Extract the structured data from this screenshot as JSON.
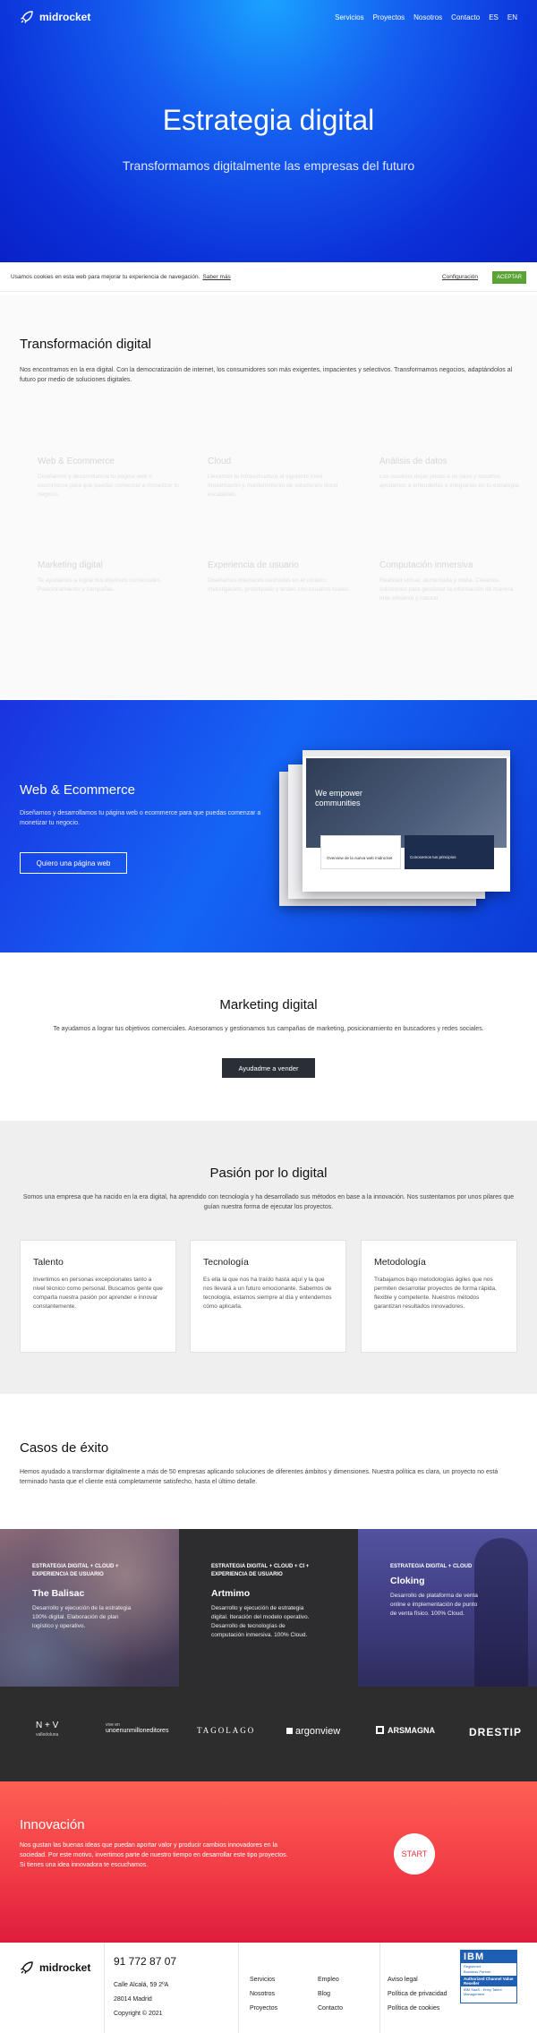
{
  "nav": {
    "brand": "midrocket",
    "links": [
      "Servicios",
      "Proyectos",
      "Nosotros",
      "Contacto",
      "ES",
      "EN"
    ]
  },
  "hero": {
    "title": "Estrategia digital",
    "subtitle": "Transformamos digitalmente las empresas del futuro"
  },
  "cookie": {
    "text": "Usamos cookies en esta web para mejorar tu experiencia de navegación.",
    "more": "Saber más",
    "config": "Configuración",
    "accept": "ACEPTAR"
  },
  "transform": {
    "title": "Transformación digital",
    "text": "Nos encontramos en la era digital. Con la democratización de internet, los consumidores son más exigentes, impacientes y selectivos. Transformamos negocios, adaptándolos al futuro por medio de soluciones digitales.",
    "services": [
      {
        "title": "Web & Ecommerce",
        "text": "Diseñamos y desarrollamos tu página web o ecommerce para que puedas comenzar a monetizar tu negocio."
      },
      {
        "title": "Cloud",
        "text": "Llevamos tu infraestructura al siguiente nivel. Implantación y mantenimiento de soluciones cloud escalables."
      },
      {
        "title": "Análisis de datos",
        "text": "Los usuarios dejan pistas a su paso y nosotros ayudamos a entenderlas e integrarlas en tu estrategia."
      },
      {
        "title": "Marketing digital",
        "text": "Te ayudamos a lograr tus objetivos comerciales. Posicionamiento y campañas."
      },
      {
        "title": "Experiencia de usuario",
        "text": "Diseñamos interfaces centradas en el usuario. Investigación, prototipado y testeo con usuarios reales."
      },
      {
        "title": "Computación inmersiva",
        "text": "Realidad virtual, aumentada y mixta. Creamos soluciones para gestionar la información de manera más eficiente y natural."
      }
    ]
  },
  "web": {
    "title": "Web & Ecommerce",
    "text": "Diseñamos y desarrollamos tu página web o ecommerce para que puedas comenzar a monetizar tu negocio.",
    "button": "Quiero una página web",
    "mock_heading": "We empower communities",
    "mock_card1": "Overview de la nueva web midrocket",
    "mock_card2": "Conocemos tus principios"
  },
  "marketing": {
    "title": "Marketing digital",
    "text": "Te ayudamos a lograr tus objetivos comerciales. Asesoramos y gestionamos tus campañas de marketing, posicionamiento en buscadores y redes sociales.",
    "button": "Ayudadme a vender"
  },
  "pasion": {
    "title": "Pasión por lo digital",
    "text": "Somos una empresa que ha nacido en la era digital, ha aprendido con tecnología y ha desarrollado sus métodos en base a la innovación. Nos sustentamos por unos pilares que guían nuestra forma de ejecutar los proyectos.",
    "cards": [
      {
        "title": "Talento",
        "text": "Invertimos en personas excepcionales tanto a nivel técnico como personal. Buscamos gente que comparta nuestra pasión por aprender e innovar constantemente."
      },
      {
        "title": "Tecnología",
        "text": "Es ella la que nos ha traído hasta aquí y la que nos llevará a un futuro emocionante. Sabemos de tecnología, estamos siempre al día y entendemos cómo aplicarla."
      },
      {
        "title": "Metodología",
        "text": "Trabajamos bajo metodologías ágiles que nos permiten desarrollar proyectos de forma rápida, flexible y competente. Nuestros métodos garantizan resultados innovadores."
      }
    ]
  },
  "casos": {
    "title": "Casos de éxito",
    "text": "Hemos ayudado a transformar digitalmente a más de 50 empresas aplicando soluciones de diferentes ámbitos y dimensiones. Nuestra política es clara, un proyecto no está terminado hasta que el cliente está completamente satisfecho, hasta el último detalle.",
    "items": [
      {
        "tag": "ESTRATEGIA DIGITAL + CLOUD + EXPERIENCIA DE USUARIO",
        "name": "The Balisac",
        "text": "Desarrollo y ejecución de la estrategia 100% digital. Elaboración de plan logístico y operativo."
      },
      {
        "tag": "ESTRATEGIA DIGITAL + CLOUD + CI + EXPERIENCIA DE USUARIO",
        "name": "Artmimo",
        "text": "Desarrollo y ejecución de estrategia digital. Iteración del modelo operativo. Desarrollo de tecnologías de computación inmersiva. 100% Cloud."
      },
      {
        "tag": "ESTRATEGIA DIGITAL + CLOUD",
        "name": "Cloking",
        "text": "Desarrollo de plataforma de venta online e implementación de punto de venta físico. 100% Cloud."
      }
    ]
  },
  "logos": [
    "N + V",
    "unoenunmilloneditores",
    "TAGOLAGO",
    "argonview",
    "ARSMAGNA",
    "DRESTIP"
  ],
  "logos_small": {
    "nv_sub": "valledoluna",
    "uno_sub": "vive en"
  },
  "innovacion": {
    "title": "Innovación",
    "text": "Nos gustan las buenas ideas que puedan aportar valor y producir cambios innovadores en la sociedad. Por este motivo, invertimos parte de nuestro tiempo en desarrollar este tipo proyectos. Si tienes una idea innovadora te escuchamos.",
    "button": "START"
  },
  "footer": {
    "brand": "midrocket",
    "phone": "91 772 87 07",
    "address1": "Calle Alcalá, 59 2ºA",
    "address2": "28014 Madrid",
    "copyright": "Copyright © 2021",
    "links1": [
      "Servicios",
      "Nosotros",
      "Proyectos"
    ],
    "links2": [
      "Empleo",
      "Blog",
      "Contacto"
    ],
    "links3": [
      "Aviso legal",
      "Política de privacidad",
      "Política de cookies"
    ],
    "ibm": {
      "logo": "IBM",
      "line1": "Registered",
      "line2": "Business Partner",
      "line3": "Authorized Channel Value Reseller",
      "line4": "IBM SaaS - Entry Talent Management"
    }
  },
  "colors": {
    "hero": "#1560f0",
    "accept": "#5aa334",
    "innovacion": "#f23c46"
  }
}
